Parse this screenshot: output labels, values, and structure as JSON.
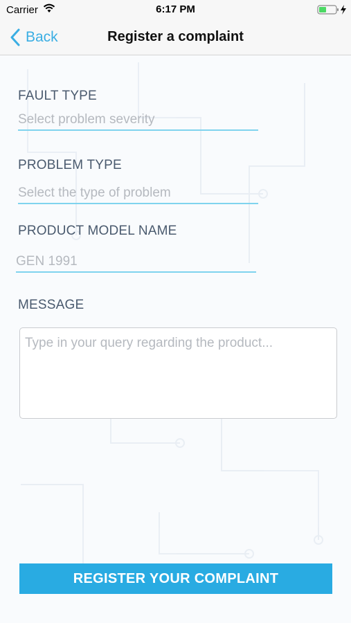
{
  "status_bar": {
    "carrier": "Carrier",
    "time": "6:17 PM",
    "icons": [
      "wifi-icon",
      "battery-icon",
      "charging-bolt-icon"
    ]
  },
  "nav": {
    "back_label": "Back",
    "back_icon": "chevron-left-icon",
    "title": "Register a complaint"
  },
  "form": {
    "fault_type": {
      "label": "FAULT TYPE",
      "placeholder": "Select problem severity",
      "value": ""
    },
    "problem_type": {
      "label": "PROBLEM TYPE",
      "placeholder": "Select the type of problem",
      "value": ""
    },
    "product_model": {
      "label": "PRODUCT MODEL NAME",
      "placeholder": "GEN 1991",
      "value": ""
    },
    "message": {
      "label": "MESSAGE",
      "placeholder": "Type in your query regarding the product...",
      "value": ""
    }
  },
  "submit": {
    "label": "REGISTER YOUR COMPLAINT"
  },
  "colors": {
    "accent": "#29abe2",
    "back_link": "#3aaee3",
    "input_underline": "#7fd3ee",
    "label_text": "#4a5a6e",
    "placeholder_text": "#b5b9bf",
    "battery_fill": "#4cd964"
  }
}
